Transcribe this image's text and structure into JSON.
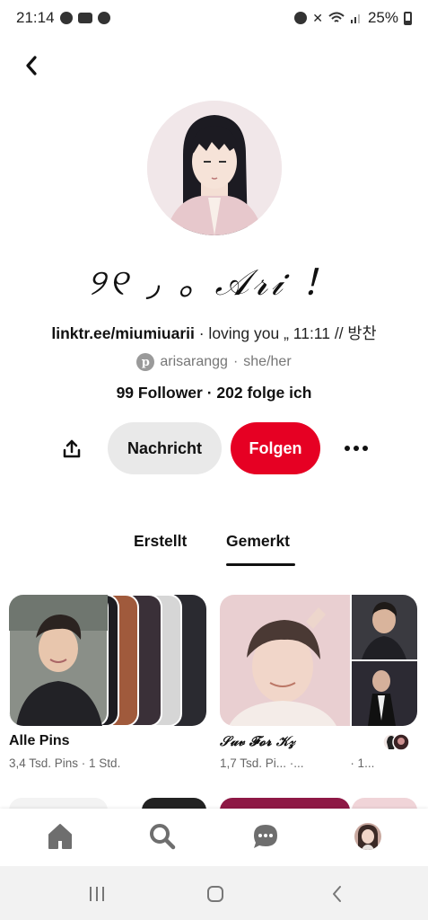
{
  "status_bar": {
    "time": "21:14",
    "battery": "25%"
  },
  "profile": {
    "display_name": "୨୧ ◞ ｡ 𝒜𝓇𝒾 ！",
    "bio_link": "linktr.ee/miumiuarii",
    "bio_rest": " · loving you „ 11:11 // 방찬",
    "username": "arisarangg",
    "pronoun_sep": " · ",
    "pronouns": "she/her",
    "stats": "99 Follower · 202 folge ich"
  },
  "actions": {
    "message": "Nachricht",
    "follow": "Folgen"
  },
  "tabs": [
    {
      "label": "Erstellt",
      "active": false
    },
    {
      "label": "Gemerkt",
      "active": true
    }
  ],
  "boards": [
    {
      "title": "Alle Pins",
      "meta": "3,4 Tsd. Pins · 1 Std."
    },
    {
      "title": "𝒮𝓊𝓋 𝓕𝓸𝓻 𝒦𝓏",
      "meta": "1,7 Tsd. Pi...  ·...",
      "meta_right": "· 1..."
    }
  ],
  "colors": {
    "accent": "#e60023",
    "button_gray": "#e9e9e9",
    "muted_text": "#767676"
  },
  "icons": {
    "back": "chevron-left-icon",
    "share": "share-icon",
    "more": "more-horizontal-icon",
    "home": "home-icon",
    "search": "search-icon",
    "messages": "chat-bubble-icon"
  }
}
